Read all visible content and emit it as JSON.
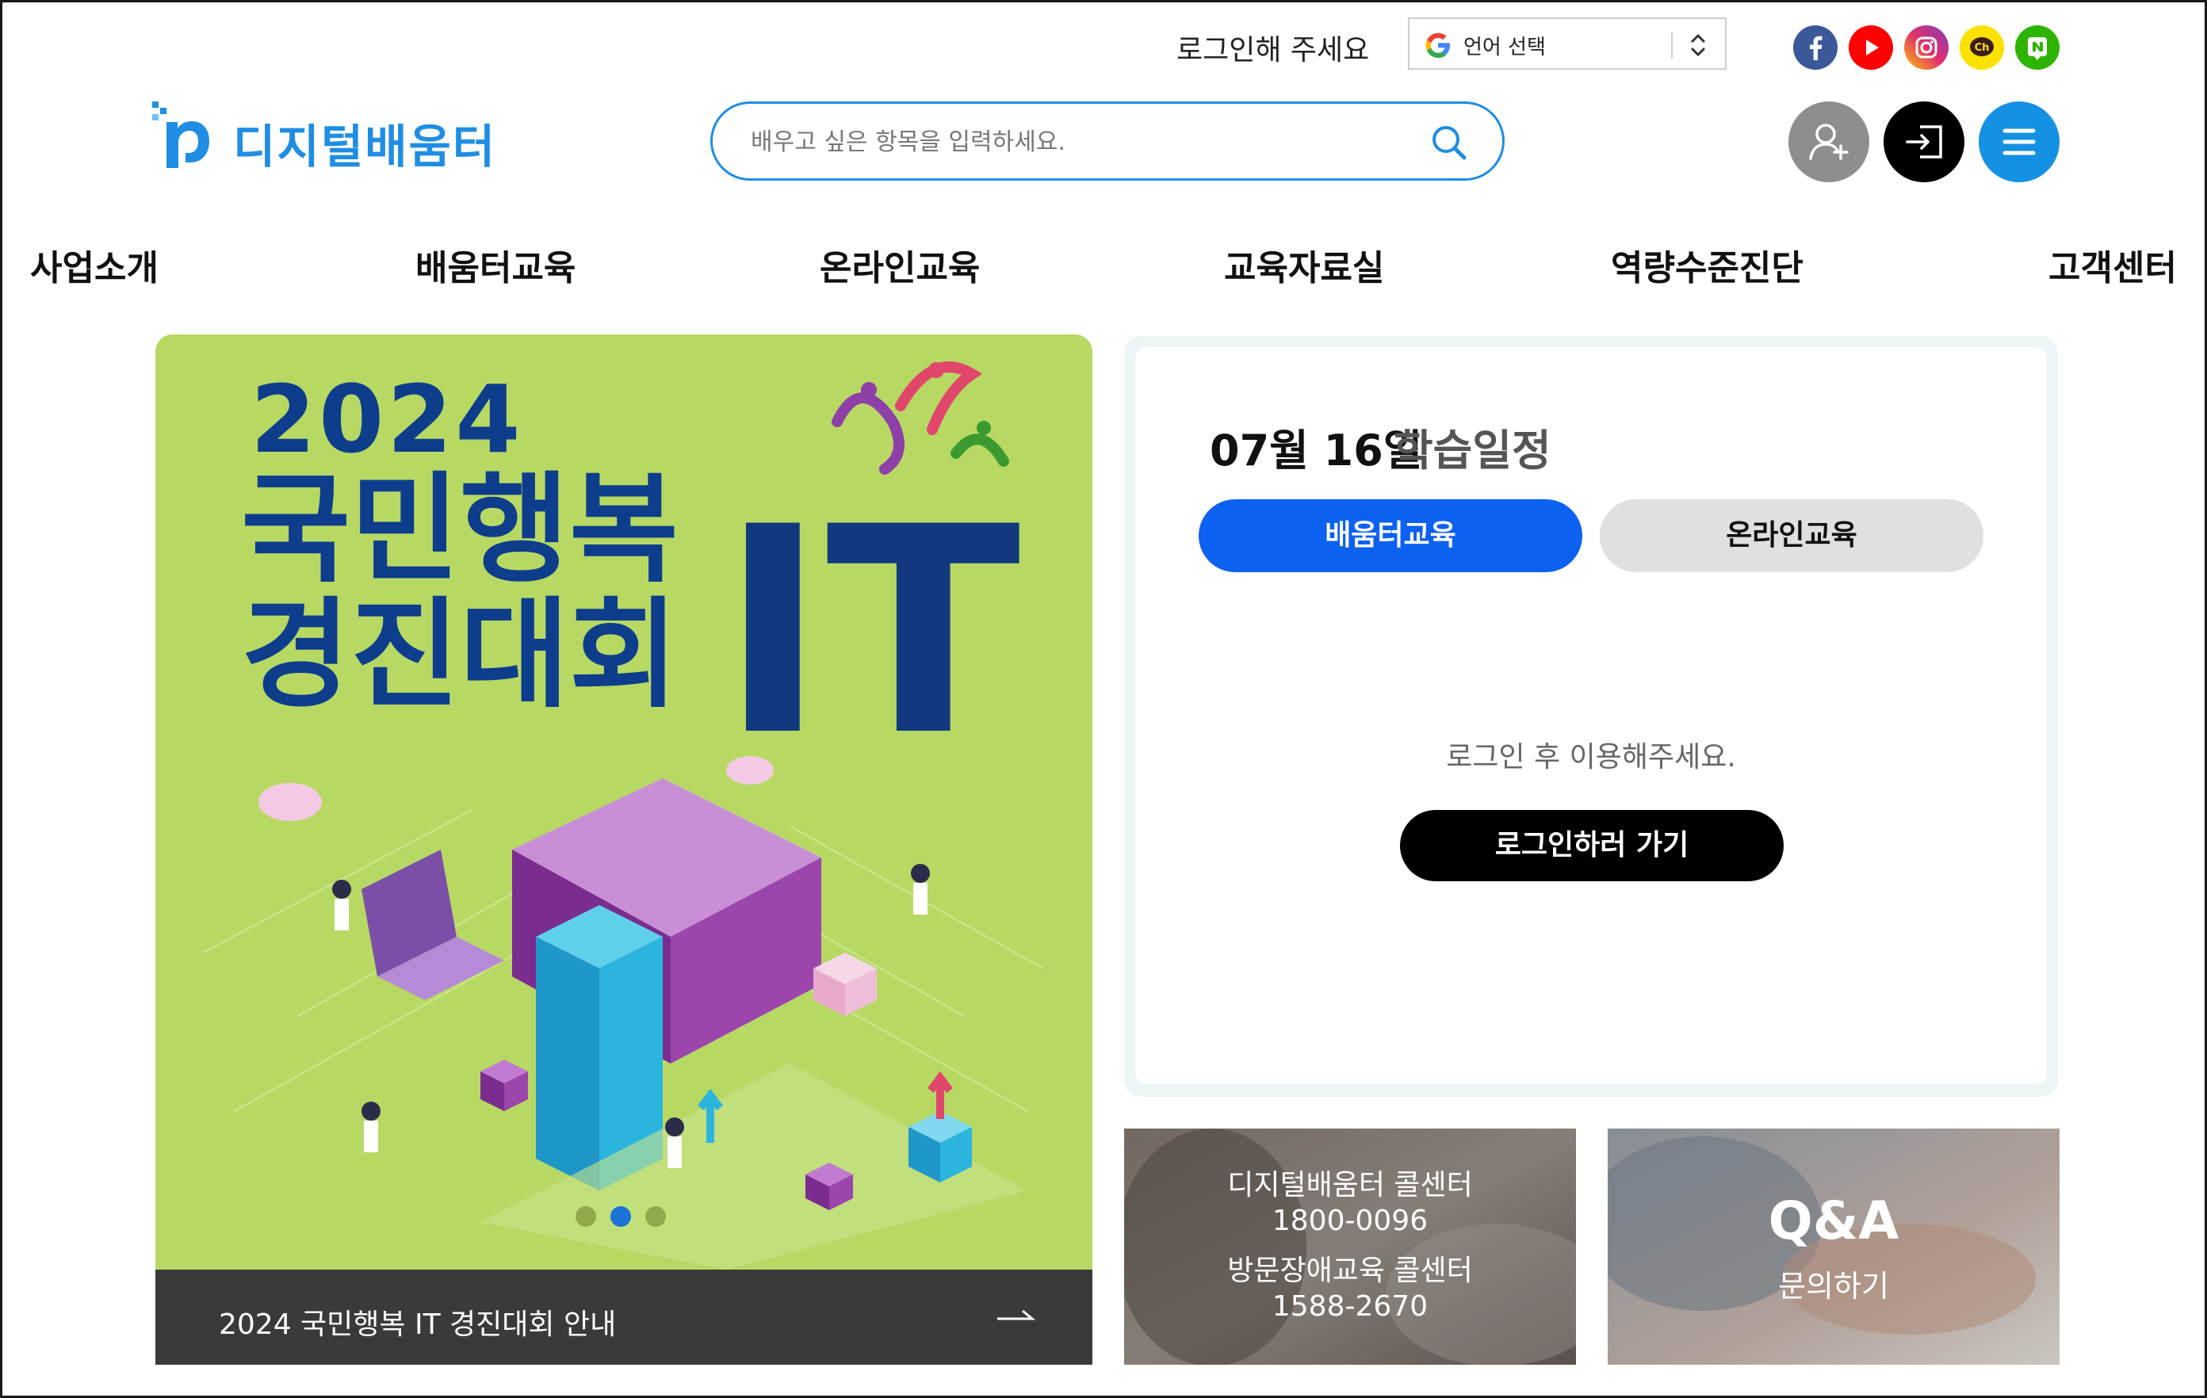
{
  "header": {
    "login_prompt": "로그인해 주세요",
    "language_select": "언어 선택",
    "social_links": [
      {
        "name": "facebook",
        "color": "#3b5998",
        "glyph": "f"
      },
      {
        "name": "youtube",
        "color": "#ff0000",
        "glyph": "▶"
      },
      {
        "name": "instagram",
        "color": "#d6249f",
        "glyph": "◎"
      },
      {
        "name": "kakao-channel",
        "color": "#fae100",
        "glyph": "Ch"
      },
      {
        "name": "naver-blog",
        "color": "#2db400",
        "glyph": "N"
      }
    ]
  },
  "logo": {
    "text": "디지털배움터",
    "color": "#1f8de3"
  },
  "search": {
    "placeholder": "배우고 싶은 항목을 입력하세요."
  },
  "header_buttons": [
    {
      "name": "signup",
      "color": "#8e8e8e",
      "icon": "add-user-icon"
    },
    {
      "name": "login",
      "color": "#000000",
      "icon": "login-icon"
    },
    {
      "name": "menu",
      "color": "#1591e3",
      "icon": "hamburger-icon"
    }
  ],
  "nav": [
    "사업소개",
    "배움터교육",
    "온라인교육",
    "교육자료실",
    "역량수준진단",
    "고객센터"
  ],
  "banner": {
    "year": "2024",
    "headline_line1": "국민행복",
    "headline_line2": "경진대회",
    "headline_it": "IT",
    "caption": "2024 국민행복 IT 경진대회 안내",
    "slide_count": 3,
    "active_slide": 2,
    "background_color": "#b7d964",
    "headline_color": "#0e3d8c"
  },
  "schedule": {
    "date": "07월 16일",
    "title": "학습일정",
    "tabs": [
      {
        "label": "배움터교육",
        "active": true
      },
      {
        "label": "온라인교육",
        "active": false
      }
    ],
    "message": "로그인 후 이용해주세요.",
    "button": "로그인하러 가기"
  },
  "call_center": {
    "line1": "디지털배움터 콜센터",
    "line2": "1800-0096",
    "line3": "방문장애교육 콜센터",
    "line4": "1588-2670"
  },
  "qa": {
    "title": "Q&A",
    "subtitle": "문의하기"
  }
}
